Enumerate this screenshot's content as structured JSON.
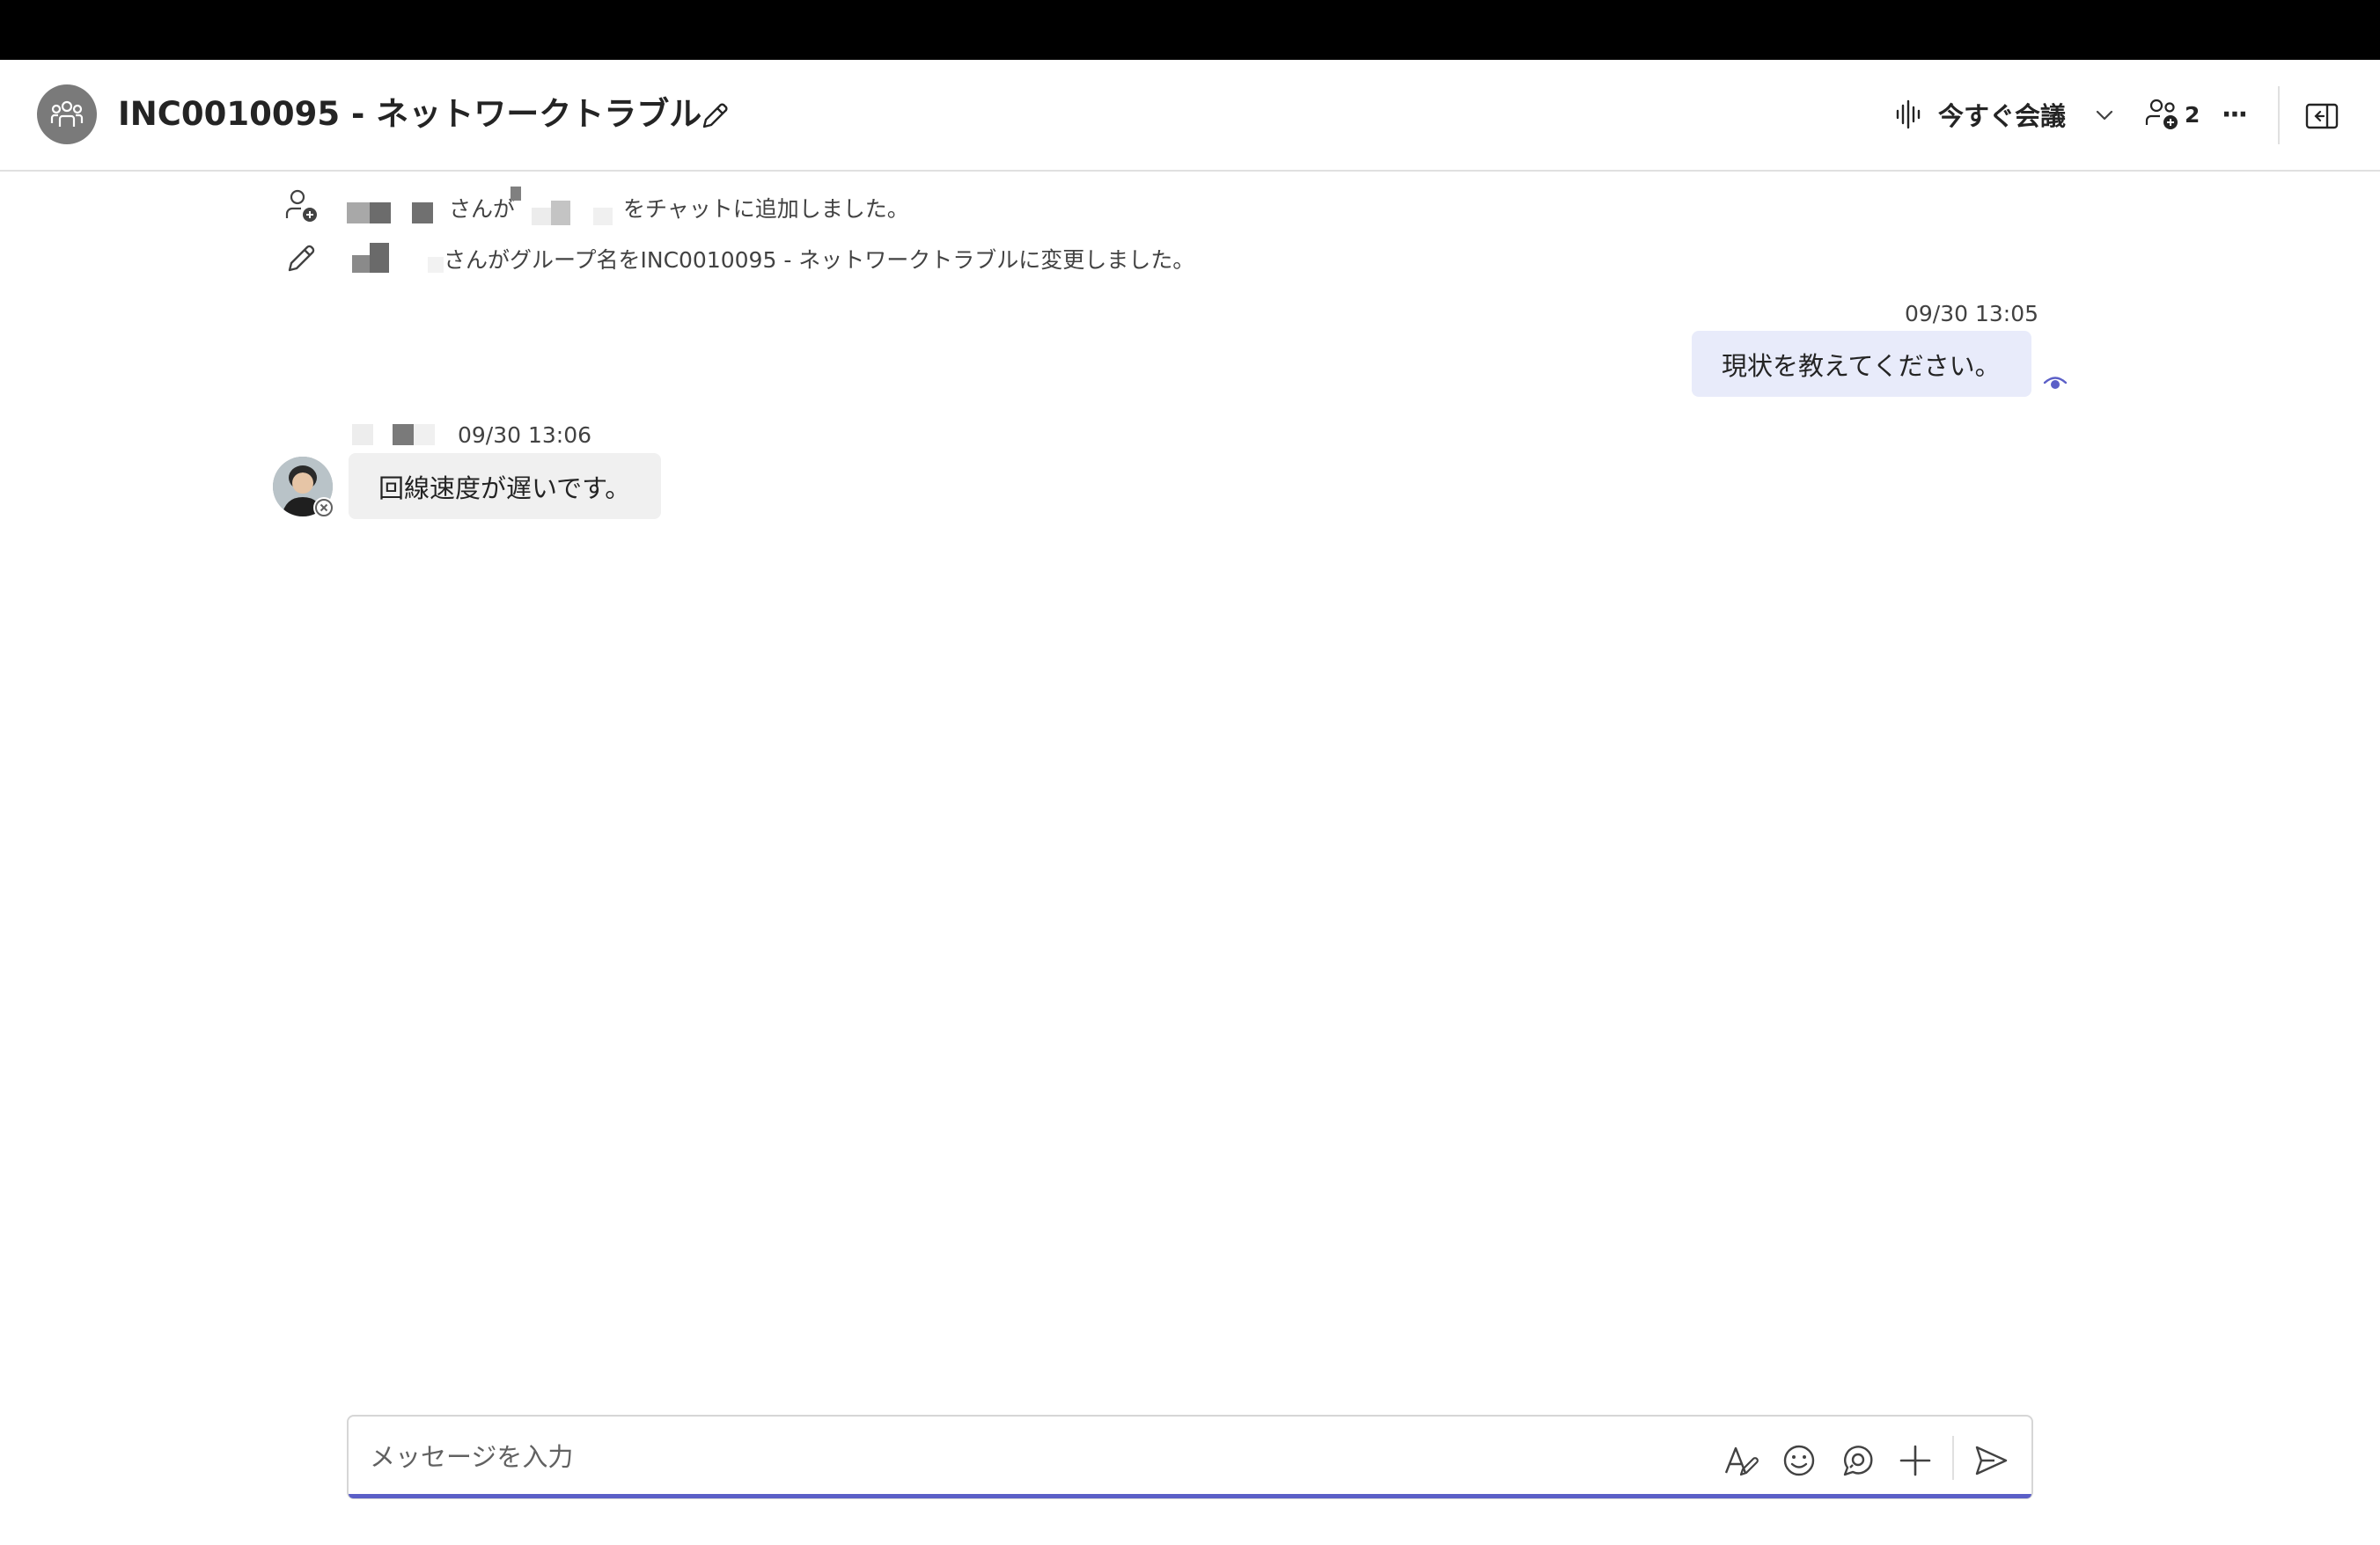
{
  "header": {
    "title": "INC0010095 - ネットワークトラブル",
    "meet_label": "今すぐ会議",
    "participant_count": "2",
    "more_label": "···"
  },
  "system_messages": [
    {
      "icon": "person-add-icon",
      "text_a": "さんが",
      "text_b": "をチャットに追加しました。"
    },
    {
      "icon": "pencil-icon",
      "text": "さんがグループ名をINC0010095 - ネットワークトラブルに変更しました。"
    }
  ],
  "messages": [
    {
      "sender": "me",
      "time": "09/30 13:05",
      "text": "現状を教えてください。"
    },
    {
      "sender": "other",
      "time": "09/30 13:06",
      "text": "回線速度が遅いです。"
    }
  ],
  "composer": {
    "placeholder": "メッセージを入力",
    "value": ""
  },
  "colors": {
    "accent": "#5b5fc7",
    "my_bubble": "#e8ebfa",
    "their_bubble": "#f0f0f0",
    "topbar": "#000000"
  }
}
